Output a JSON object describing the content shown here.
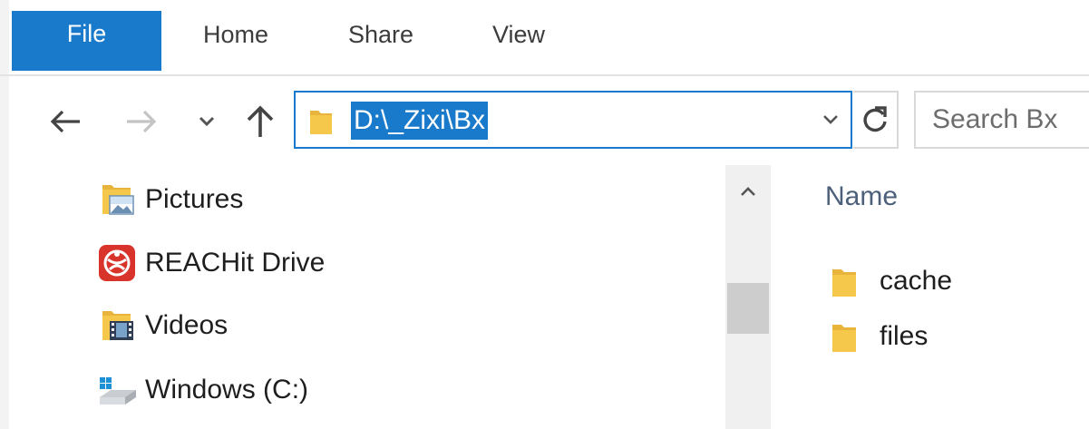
{
  "ribbon": {
    "tabs": [
      {
        "label": "File",
        "active": true
      },
      {
        "label": "Home"
      },
      {
        "label": "Share"
      },
      {
        "label": "View"
      }
    ]
  },
  "navigation": {
    "back_icon": "arrow-left-icon",
    "forward_icon": "arrow-right-icon",
    "recent_icon": "chevron-down-icon",
    "up_icon": "arrow-up-icon",
    "address": {
      "path": "D:\\_Zixi\\Bx",
      "dropdown_icon": "chevron-down-icon"
    },
    "refresh_icon": "refresh-icon",
    "search": {
      "placeholder": "Search Bx"
    }
  },
  "nav_pane": {
    "items": [
      {
        "label": "Pictures",
        "icon": "pictures-folder-icon"
      },
      {
        "label": "REACHit Drive",
        "icon": "reachit-drive-icon"
      },
      {
        "label": "Videos",
        "icon": "videos-folder-icon"
      },
      {
        "label": "Windows (C:)",
        "icon": "windows-drive-icon"
      }
    ]
  },
  "file_list": {
    "columns": [
      "Name"
    ],
    "rows": [
      {
        "name": "cache",
        "icon": "folder-icon"
      },
      {
        "name": "files",
        "icon": "folder-icon"
      }
    ]
  },
  "colors": {
    "accent": "#1979ca",
    "folder": "#f5c84c",
    "reachit_red": "#d9342b"
  }
}
